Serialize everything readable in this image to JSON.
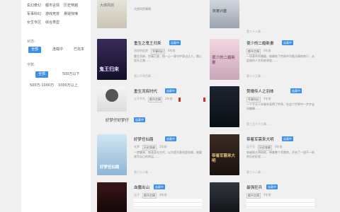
{
  "filters": {
    "category_rows": [
      [
        "玄幻奇幻",
        "都市言情",
        "历史穿越"
      ],
      [
        "军事科幻",
        "游戏竞技",
        "悬疑惊悚"
      ],
      [
        "女生专区",
        "综合类型"
      ]
    ],
    "status_label": "状态:",
    "status_options": [
      "全部",
      "连载中",
      "已完本"
    ],
    "wordcount_label": "字数:",
    "wordcount_options": [
      "全部",
      "500万以下",
      "500万-1000万",
      "1000万以上"
    ]
  },
  "books": [
    {
      "title": "",
      "desc": "大侠风剑事情",
      "foot": "",
      "cover_text": "大侠风剑",
      "cover_colors": [
        "#e8e6df",
        "#c9c4b4"
      ]
    },
    {
      "title": "",
      "desc": "",
      "foot": "第六十八章 ...",
      "cover_text": "玩家兴盛",
      "cover_colors": [
        "#d8dde4",
        "#9aa3ad"
      ]
    },
    {
      "title": "重生之鬼王归来",
      "badge": "连载中",
      "author": "流浪的追梦",
      "genre": "军事科幻",
      "time": "4年前",
      "desc": "重生而来，世事已变，他一心一意守护身边之人，踏上逆天之路……",
      "foot": "第二千四百章 ...",
      "cover_text": "鬼王归来",
      "cover_colors": [
        "#3a2a5a",
        "#121028"
      ]
    },
    {
      "title": "夜少的二婚新妻",
      "badge": "连载中",
      "author": "",
      "genre": "都市言情",
      "time": "4年前",
      "desc": "一场意外的婚姻，她嫁给了传闻中冷酷无情的夜少，从此她的人生彻底改变……",
      "foot": "第八十九章 ...",
      "cover_text": "夜少的二婚新妻",
      "cover_colors": [
        "#f3d6e0",
        "#c9a6b8"
      ]
    },
    {
      "title": "重生流庶时代",
      "badge": "连载中",
      "author": "公子不凡",
      "genre": "都市言情",
      "time": "2年前",
      "desc": "",
      "foot": "",
      "cover_text": "",
      "cover_colors": [
        "#f4f4f4",
        "#dcdcdc"
      ]
    },
    {
      "title": "赘婿传人之羽体",
      "badge": "连载中",
      "author": "",
      "genre": "军事科幻",
      "time": "4年前",
      "desc": "一个平凡少年意外获得了传承，在这个世界中一步步走向巅峰……",
      "foot": "第三百七十九章 ...",
      "cover_text": "",
      "cover_colors": [
        "#1b2430",
        "#0b0f16"
      ]
    },
    {
      "title": "好梦仔好梦仔",
      "badge": "连载中",
      "author": "",
      "genre": "",
      "time": "",
      "desc": "",
      "foot": "",
      "cover_text": "",
      "cover_colors": []
    },
    {
      "title": "好梦任仙路",
      "badge": "连载中",
      "author": "长梦",
      "genre": "历史穿越",
      "time": "2年前",
      "desc": "一梦醒来，她竟身在古代，以为是天意也是机缘，她要改写自己的命运……",
      "foot": "第六十八章 ...",
      "cover_text": "好梦任仙路",
      "cover_colors": [
        "#cfe6f2",
        "#8fb6d6"
      ]
    },
    {
      "title": "带着军需来大明",
      "badge": "连载中",
      "author": "吉子天",
      "genre": "历史穿越",
      "time": "4年前",
      "desc": "穿越到大明的他，带着整个军需库，开启了一段不一样的历史征程……",
      "foot": "第六十八章 ...",
      "cover_text": "带着军需来大明",
      "cover_colors": [
        "#3a2b22",
        "#1a120e"
      ]
    },
    {
      "title": "血魔出山",
      "badge": "连载中",
      "author": "吉子",
      "genre": "都市言情",
      "time": "4年前",
      "desc": "",
      "foot": "",
      "cover_text": "",
      "cover_colors": [
        "#3a1616",
        "#140808"
      ]
    },
    {
      "title": "最强狂兵",
      "badge": "连载中",
      "author": "",
      "genre": "都市言情",
      "time": "4年前",
      "desc": "",
      "foot": "",
      "cover_text": "",
      "cover_colors": [
        "#303640",
        "#121418"
      ]
    }
  ]
}
